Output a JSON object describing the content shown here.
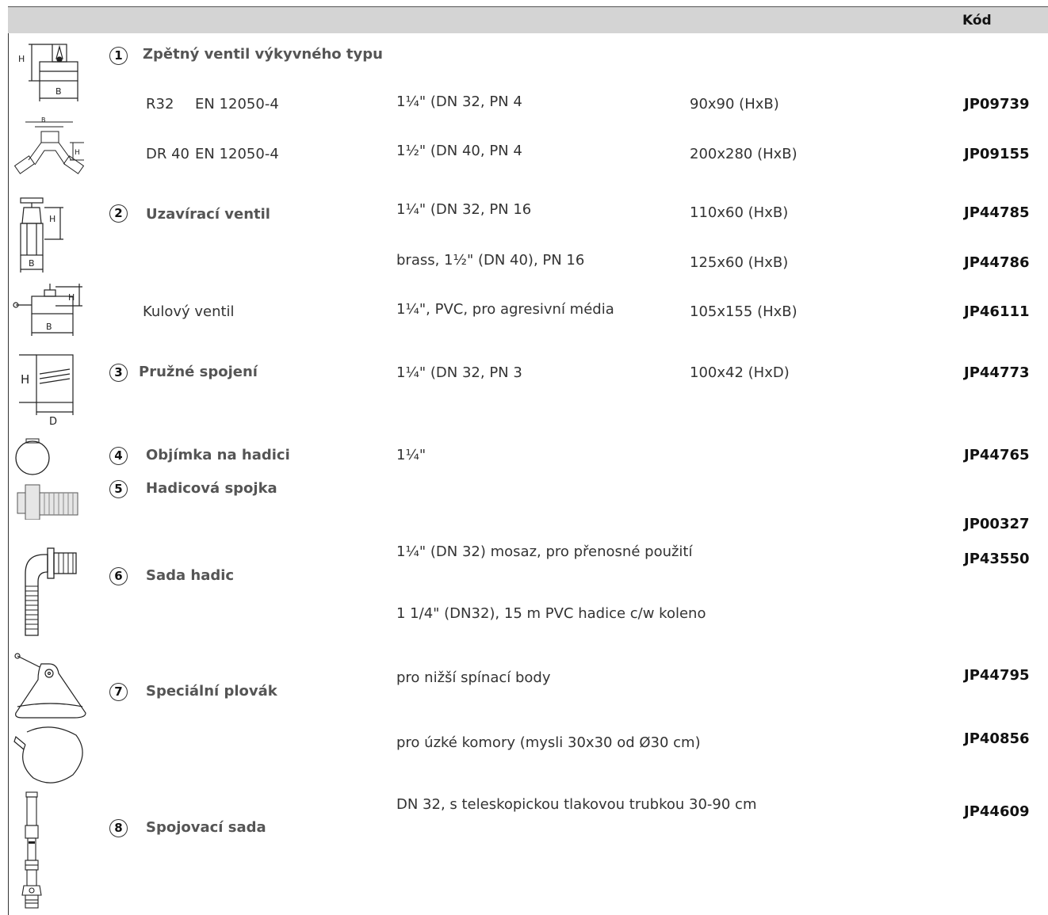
{
  "header": {
    "code_label": "Kód"
  },
  "items": {
    "check_valve": {
      "number": "1",
      "title": "Zpětný ventil výkyvného typu",
      "rows": [
        {
          "model": "R32",
          "standard": "EN 12050-4",
          "spec": "1¼\" (DN 32, PN 4",
          "size": "90x90 (HxB)",
          "code": "JP09739"
        },
        {
          "model": "DR 40",
          "standard": "EN 12050-4",
          "spec": "1½\" (DN 40, PN 4",
          "size": "200x280 (HxB)",
          "code": "JP09155"
        }
      ]
    },
    "gate_valve": {
      "number": "2",
      "title": "Uzavírací ventil",
      "rows": [
        {
          "spec": "1¼\" (DN 32, PN 16",
          "size": "110x60 (HxB)",
          "code": "JP44785"
        },
        {
          "spec": "brass, 1½\" (DN 40), PN 16",
          "size": "125x60 (HxB)",
          "code": "JP44786"
        }
      ]
    },
    "ball_valve": {
      "label": "Kulový ventil",
      "spec": "1¼\", PVC, pro agresivní média",
      "size": "105x155 (HxB)",
      "code": "JP46111"
    },
    "flex_joint": {
      "number": "3",
      "title": "Pružné spojení",
      "spec": "1¼\" (DN 32, PN 3",
      "size": "100x42 (HxD)",
      "code": "JP44773"
    },
    "hose_clamp": {
      "number": "4",
      "title": "Objímka na hadici",
      "spec": "1¼\"",
      "code": "JP44765"
    },
    "hose_coupling": {
      "number": "5",
      "title": "Hadicová spojka",
      "code": "JP00327"
    },
    "hose_set": {
      "number": "6",
      "title": "Sada hadic",
      "rows": [
        {
          "spec": "1¼\" (DN 32) mosaz, pro přenosné použití",
          "code": "JP43550"
        },
        {
          "spec": "1 1/4\" (DN32), 15 m PVC hadice c/w koleno"
        }
      ]
    },
    "special_float": {
      "number": "7",
      "title": "Speciální plovák",
      "rows": [
        {
          "spec": "pro nižší spínací body",
          "code": "JP44795"
        },
        {
          "spec": "pro úzké komory (mysli 30x30 od Ø30 cm)",
          "code": "JP40856"
        }
      ]
    },
    "connection_set": {
      "number": "8",
      "title": "Spojovací sada",
      "spec": "DN 32, s teleskopickou tlakovou trubkou 30-90 cm",
      "code": "JP44609"
    }
  },
  "drawing_labels": {
    "height": "H",
    "width": "B",
    "diameter": "D"
  }
}
